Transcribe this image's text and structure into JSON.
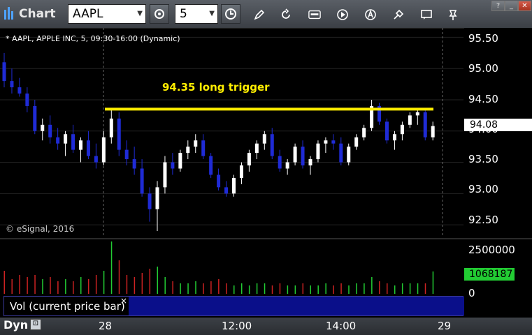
{
  "app": {
    "title": "Chart"
  },
  "toolbar": {
    "symbol": "AAPL",
    "interval": "5",
    "icons": [
      "chart-settings-icon",
      "clock-icon",
      "pencil-icon",
      "refresh-icon",
      "quote-icon",
      "play-icon",
      "alert-icon",
      "tools-icon",
      "message-icon",
      "pin-icon"
    ]
  },
  "window_controls": [
    "help",
    "minimize",
    "close"
  ],
  "chart": {
    "header": "* AAPL, APPLE INC, 5, 09:30-16:00 (Dynamic)",
    "copyright": "© eSignal, 2016",
    "annotation": "94.35 long trigger",
    "current_price": "94.08",
    "price_axis": [
      "95.50",
      "95.00",
      "94.50",
      "94.00",
      "93.50",
      "93.00",
      "92.50"
    ],
    "volume_axis": [
      "2500000",
      "0"
    ],
    "volume_current": "1068187",
    "volume_study_label": "Vol (current price bar)",
    "close_symbol": "×",
    "time_axis": [
      "28",
      "12:00",
      "14:00",
      "29"
    ],
    "dyn_label": "Dyn",
    "colors": {
      "up": "#ffffff",
      "down": "#1f2bd6",
      "trigger_line": "#ffee00",
      "vol_up": "#22cc33",
      "vol_down": "#cc2222"
    }
  },
  "chart_data": {
    "type": "candlestick",
    "ylim": [
      92.3,
      95.65
    ],
    "trigger_price": 94.35,
    "candles": [
      [
        95.1,
        95.25,
        94.7,
        94.8
      ],
      [
        94.8,
        95.0,
        94.6,
        94.7
      ],
      [
        94.7,
        94.85,
        94.55,
        94.6
      ],
      [
        94.6,
        94.7,
        94.3,
        94.4
      ],
      [
        94.4,
        94.5,
        93.95,
        94.0
      ],
      [
        94.0,
        94.2,
        93.85,
        94.1
      ],
      [
        94.1,
        94.25,
        93.8,
        93.9
      ],
      [
        93.9,
        94.05,
        93.7,
        93.8
      ],
      [
        93.8,
        94.0,
        93.6,
        93.95
      ],
      [
        93.95,
        94.1,
        93.65,
        93.7
      ],
      [
        93.7,
        93.9,
        93.5,
        93.85
      ],
      [
        93.85,
        94.0,
        93.55,
        93.6
      ],
      [
        93.6,
        93.8,
        93.4,
        93.5
      ],
      [
        93.5,
        94.0,
        93.45,
        93.9
      ],
      [
        93.9,
        94.35,
        93.8,
        94.2
      ],
      [
        94.2,
        94.3,
        93.6,
        93.7
      ],
      [
        93.7,
        93.85,
        93.45,
        93.55
      ],
      [
        93.55,
        93.75,
        93.3,
        93.4
      ],
      [
        93.4,
        93.55,
        92.95,
        93.0
      ],
      [
        93.0,
        93.1,
        92.55,
        92.75
      ],
      [
        92.75,
        93.2,
        92.4,
        93.1
      ],
      [
        93.1,
        93.6,
        93.0,
        93.5
      ],
      [
        93.5,
        93.65,
        93.3,
        93.4
      ],
      [
        93.4,
        93.7,
        93.35,
        93.65
      ],
      [
        93.65,
        93.85,
        93.55,
        93.75
      ],
      [
        93.75,
        93.95,
        93.65,
        93.85
      ],
      [
        93.85,
        93.95,
        93.55,
        93.6
      ],
      [
        93.6,
        93.65,
        93.25,
        93.3
      ],
      [
        93.3,
        93.4,
        93.05,
        93.1
      ],
      [
        93.1,
        93.2,
        92.95,
        93.0
      ],
      [
        93.0,
        93.3,
        92.95,
        93.25
      ],
      [
        93.25,
        93.5,
        93.15,
        93.45
      ],
      [
        93.45,
        93.7,
        93.35,
        93.65
      ],
      [
        93.65,
        93.85,
        93.55,
        93.8
      ],
      [
        93.8,
        94.0,
        93.7,
        93.95
      ],
      [
        93.95,
        94.05,
        93.55,
        93.6
      ],
      [
        93.6,
        93.7,
        93.35,
        93.4
      ],
      [
        93.4,
        93.55,
        93.3,
        93.5
      ],
      [
        93.5,
        93.8,
        93.45,
        93.75
      ],
      [
        93.75,
        93.85,
        93.4,
        93.45
      ],
      [
        93.45,
        93.6,
        93.3,
        93.55
      ],
      [
        93.55,
        93.85,
        93.5,
        93.8
      ],
      [
        93.8,
        93.9,
        93.65,
        93.85
      ],
      [
        93.85,
        93.95,
        93.7,
        93.8
      ],
      [
        93.8,
        93.9,
        93.45,
        93.5
      ],
      [
        93.5,
        93.8,
        93.45,
        93.75
      ],
      [
        93.75,
        93.95,
        93.7,
        93.9
      ],
      [
        93.9,
        94.1,
        93.85,
        94.05
      ],
      [
        94.05,
        94.5,
        94.0,
        94.4
      ],
      [
        94.4,
        94.45,
        94.1,
        94.15
      ],
      [
        94.15,
        94.2,
        93.8,
        93.85
      ],
      [
        93.85,
        94.0,
        93.7,
        93.95
      ],
      [
        93.95,
        94.15,
        93.85,
        94.1
      ],
      [
        94.1,
        94.3,
        94.05,
        94.25
      ],
      [
        94.25,
        94.35,
        94.1,
        94.3
      ],
      [
        94.3,
        94.35,
        93.85,
        93.9
      ],
      [
        93.9,
        94.15,
        93.85,
        94.08
      ]
    ],
    "volume": [
      1100000,
      700000,
      900000,
      800000,
      900000,
      700000,
      800000,
      600000,
      700000,
      600000,
      800000,
      700000,
      900000,
      1100000,
      2500000,
      1600000,
      900000,
      800000,
      1000000,
      1200000,
      1300000,
      800000,
      600000,
      500000,
      500000,
      600000,
      500000,
      600000,
      700000,
      500000,
      400000,
      500000,
      400000,
      500000,
      500000,
      400000,
      500000,
      400000,
      400000,
      500000,
      400000,
      400000,
      500000,
      400000,
      500000,
      400000,
      500000,
      500000,
      800000,
      600000,
      500000,
      400000,
      500000,
      500000,
      500000,
      500000,
      1068187
    ]
  }
}
